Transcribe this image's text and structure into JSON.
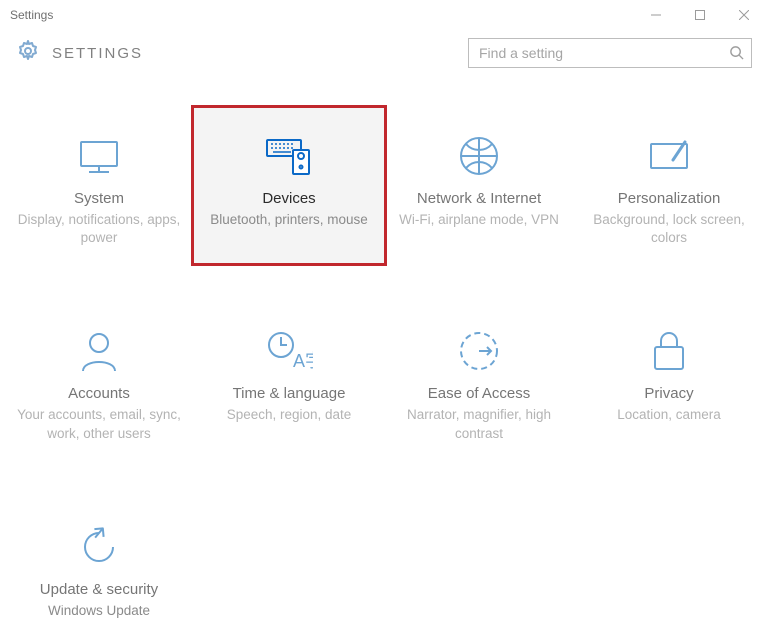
{
  "window": {
    "title": "Settings"
  },
  "header": {
    "app_title": "SETTINGS"
  },
  "search": {
    "placeholder": "Find a setting"
  },
  "tiles": [
    {
      "name": "system",
      "title": "System",
      "desc": "Display, notifications, apps, power"
    },
    {
      "name": "devices",
      "title": "Devices",
      "desc": "Bluetooth, printers, mouse",
      "highlighted": true
    },
    {
      "name": "network",
      "title": "Network & Internet",
      "desc": "Wi-Fi, airplane mode, VPN"
    },
    {
      "name": "personal",
      "title": "Personalization",
      "desc": "Background, lock screen, colors"
    },
    {
      "name": "accounts",
      "title": "Accounts",
      "desc": "Your accounts, email, sync, work, other users"
    },
    {
      "name": "time",
      "title": "Time & language",
      "desc": "Speech, region, date"
    },
    {
      "name": "ease",
      "title": "Ease of Access",
      "desc": "Narrator, magnifier, high contrast"
    },
    {
      "name": "privacy",
      "title": "Privacy",
      "desc": "Location, camera"
    },
    {
      "name": "update",
      "title": "Update & security",
      "desc": "Windows Update"
    }
  ],
  "colors": {
    "accent": "#1e74bc",
    "highlight_border": "#c1272d",
    "highlight_bg": "#f4f4f4"
  }
}
